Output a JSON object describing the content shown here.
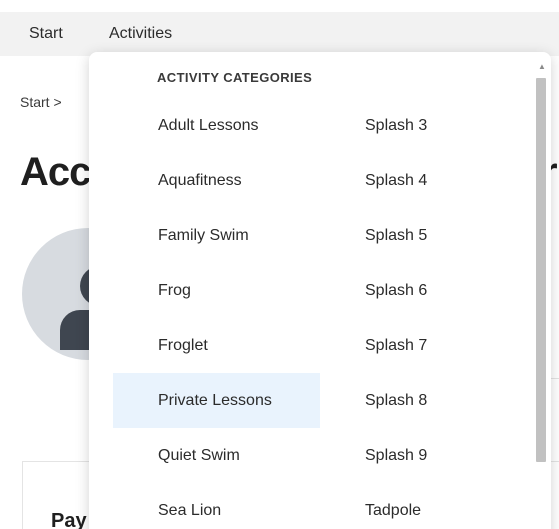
{
  "nav": {
    "start": "Start",
    "activities": "Activities"
  },
  "page": {
    "breadcrumb": "Start >",
    "title_fragment": "Acc",
    "title_right_fragment": "r",
    "pay_fragment": "Pay"
  },
  "dropdown": {
    "heading": "ACTIVITY CATEGORIES",
    "col1": [
      "Adult Lessons",
      "Aquafitness",
      "Family Swim",
      "Frog",
      "Froglet",
      "Private Lessons",
      "Quiet Swim",
      "Sea Lion"
    ],
    "col2": [
      "Splash 3",
      "Splash 4",
      "Splash 5",
      "Splash 6",
      "Splash 7",
      "Splash 8",
      "Splash 9",
      "Tadpole"
    ],
    "hovered_item": "Private Lessons"
  },
  "colors": {
    "hover_bg": "#e9f3fd",
    "nav_bg": "#f2f2f2",
    "avatar_bg": "#d7dbe0",
    "avatar_icon": "#3f4650"
  }
}
